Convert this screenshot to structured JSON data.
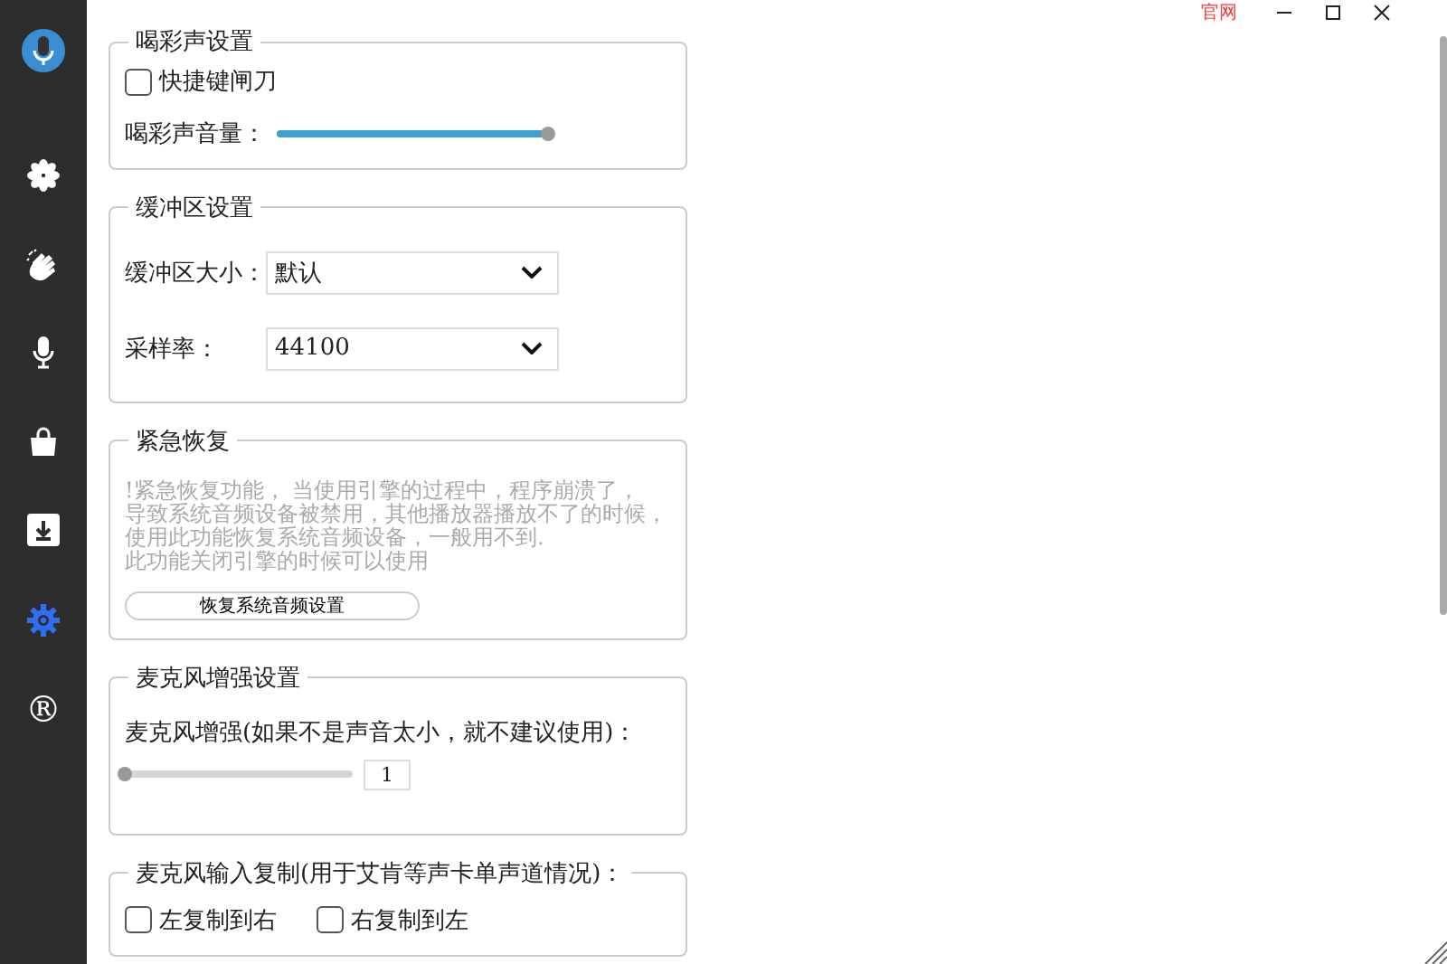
{
  "sidebar": {
    "items": [
      {
        "kind": "flower",
        "selected": false
      },
      {
        "kind": "hands",
        "selected": false
      },
      {
        "kind": "mic",
        "selected": false
      },
      {
        "kind": "bag",
        "selected": false
      },
      {
        "kind": "download",
        "selected": false
      },
      {
        "kind": "gear",
        "selected": true
      },
      {
        "kind": "glyph",
        "label": "®",
        "selected": false
      }
    ]
  },
  "title_bar": {
    "link": "官网"
  },
  "sections": [
    {
      "title": "喝彩声设置",
      "rows": [
        {
          "kind": "checkbox",
          "label": "快捷键闸刀",
          "checked": false
        },
        {
          "kind": "slider",
          "label": "喝彩声音量：",
          "level": 1
        }
      ]
    },
    {
      "title": "缓冲区设置",
      "rows": [
        {
          "kind": "select",
          "label": "缓冲区大小：",
          "value": "默认"
        },
        {
          "kind": "select",
          "label": "采样率：",
          "value": "44100"
        }
      ]
    },
    {
      "title": "紧急恢复",
      "rows": [
        {
          "kind": "note",
          "lines": [
            "!紧急恢复功能， 当使用引擎的过程中，程序崩溃了，",
            "导致系统音频设备被禁用，其他播放器播放不了的时候，",
            "使用此功能恢复系统音频设备，一般用不到.",
            "此功能关闭引擎的时候可以使用"
          ]
        },
        {
          "kind": "button",
          "label": "恢复系统音频设置"
        }
      ]
    },
    {
      "title": "麦克风增强设置",
      "rows": [
        {
          "kind": "text",
          "label": "麦克风增强(如果不是声音太小，就不建议使用)："
        },
        {
          "kind": "boost",
          "level": 0,
          "value": "1"
        }
      ]
    },
    {
      "title": "麦克风输入复制(用于艾肯等声卡单声道情况)：",
      "rows": [
        {
          "kind": "checkpair",
          "items": [
            {
              "label": "左复制到右",
              "checked": false
            },
            {
              "label": "右复制到左",
              "checked": false
            }
          ]
        }
      ]
    }
  ]
}
